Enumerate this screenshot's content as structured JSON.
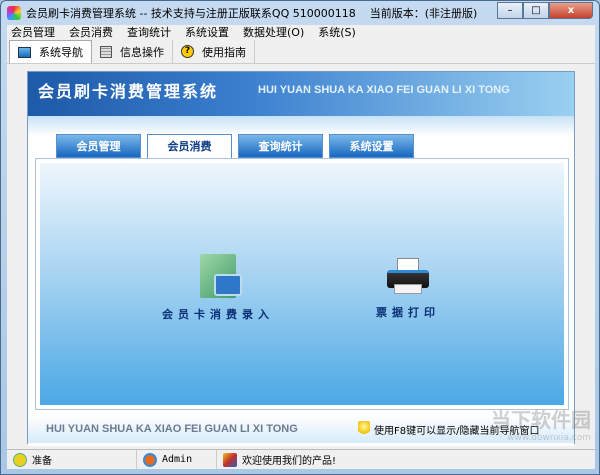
{
  "window": {
    "title": "会员刷卡消费管理系统 -- 技术支持与注册正版联系QQ 510000118    当前版本：(非注册版)",
    "min": "–",
    "max": "□",
    "close": "x"
  },
  "menu": [
    "会员管理",
    "会员消费",
    "查询统计",
    "系统设置",
    "数据处理(O)",
    "系统(S)"
  ],
  "toolbar": [
    {
      "label": "系统导航",
      "icon": "nav-icon"
    },
    {
      "label": "信息操作",
      "icon": "grid-icon"
    },
    {
      "label": "使用指南",
      "icon": "help-icon"
    }
  ],
  "banner": {
    "title": "会员刷卡消费管理系统",
    "subtitle": "HUI YUAN SHUA KA XIAO FEI GUAN LI XI TONG"
  },
  "tabs": [
    "会员管理",
    "会员消费",
    "查询统计",
    "系统设置"
  ],
  "actions": [
    {
      "label": "会员卡消费录入",
      "icon": "folder-icon"
    },
    {
      "label": "票据打印",
      "icon": "printer-icon"
    }
  ],
  "footer": {
    "brand": "HUI YUAN SHUA KA XIAO FEI GUAN LI XI TONG",
    "hint": "使用F8键可以显示/隐藏当前导航窗口"
  },
  "status": {
    "ready": "准备",
    "user": "Admin",
    "welcome": "欢迎使用我们的产品!"
  },
  "watermark": {
    "name": "当下软件园",
    "url": "www.downxia.com"
  }
}
